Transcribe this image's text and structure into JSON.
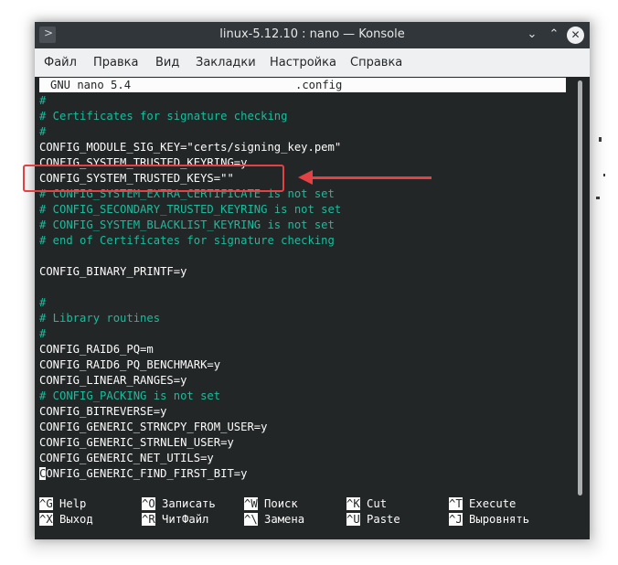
{
  "window": {
    "title": "linux-5.12.10 : nano — Konsole"
  },
  "titlebar_buttons": {
    "minimize": "⌄",
    "maximize": "⌃",
    "close": "✕",
    "app_icon": ">"
  },
  "menu": [
    "Файл",
    "Правка",
    "Вид",
    "Закладки",
    "Настройка",
    "Справка"
  ],
  "nano_header": {
    "version": "GNU nano 5.4",
    "filename": ".config"
  },
  "lines": [
    {
      "text": "#",
      "type": "comment"
    },
    {
      "text": "# Certificates for signature checking",
      "type": "comment"
    },
    {
      "text": "#",
      "type": "comment"
    },
    {
      "text": "CONFIG_MODULE_SIG_KEY=\"certs/signing_key.pem\"",
      "type": "code"
    },
    {
      "text": "CONFIG_SYSTEM_TRUSTED_KEYRING=y",
      "type": "code"
    },
    {
      "text": "CONFIG_SYSTEM_TRUSTED_KEYS=\"\"",
      "type": "code"
    },
    {
      "text": "# CONFIG_SYSTEM_EXTRA_CERTIFICATE is not set",
      "type": "comment"
    },
    {
      "text": "# CONFIG_SECONDARY_TRUSTED_KEYRING is not set",
      "type": "comment"
    },
    {
      "text": "# CONFIG_SYSTEM_BLACKLIST_KEYRING is not set",
      "type": "comment"
    },
    {
      "text": "# end of Certificates for signature checking",
      "type": "comment"
    },
    {
      "text": "",
      "type": "code"
    },
    {
      "text": "CONFIG_BINARY_PRINTF=y",
      "type": "code"
    },
    {
      "text": "",
      "type": "code"
    },
    {
      "text": "#",
      "type": "comment"
    },
    {
      "text": "# Library routines",
      "type": "comment"
    },
    {
      "text": "#",
      "type": "comment"
    },
    {
      "text": "CONFIG_RAID6_PQ=m",
      "type": "code"
    },
    {
      "text": "CONFIG_RAID6_PQ_BENCHMARK=y",
      "type": "code"
    },
    {
      "text": "CONFIG_LINEAR_RANGES=y",
      "type": "code"
    },
    {
      "text": "# CONFIG_PACKING is not set",
      "type": "comment"
    },
    {
      "text": "CONFIG_BITREVERSE=y",
      "type": "code"
    },
    {
      "text": "CONFIG_GENERIC_STRNCPY_FROM_USER=y",
      "type": "code"
    },
    {
      "text": "CONFIG_GENERIC_STRNLEN_USER=y",
      "type": "code"
    },
    {
      "text": "CONFIG_GENERIC_NET_UTILS=y",
      "type": "code"
    },
    {
      "text": "CONFIG_GENERIC_FIND_FIRST_BIT=y",
      "type": "code",
      "cursor": true
    }
  ],
  "help": [
    [
      {
        "key": "^G",
        "label": "Help"
      },
      {
        "key": "^O",
        "label": "Записать"
      },
      {
        "key": "^W",
        "label": "Поиск"
      },
      {
        "key": "^K",
        "label": "Cut"
      },
      {
        "key": "^T",
        "label": "Execute"
      }
    ],
    [
      {
        "key": "^X",
        "label": "Выход"
      },
      {
        "key": "^R",
        "label": "ЧитФайл"
      },
      {
        "key": "^\\",
        "label": "Замена"
      },
      {
        "key": "^U",
        "label": "Paste"
      },
      {
        "key": "^J",
        "label": "Выровнять"
      }
    ]
  ],
  "colors": {
    "comment": "#1abc9c",
    "annotation": "#e34143",
    "terminal_bg": "#232627"
  }
}
